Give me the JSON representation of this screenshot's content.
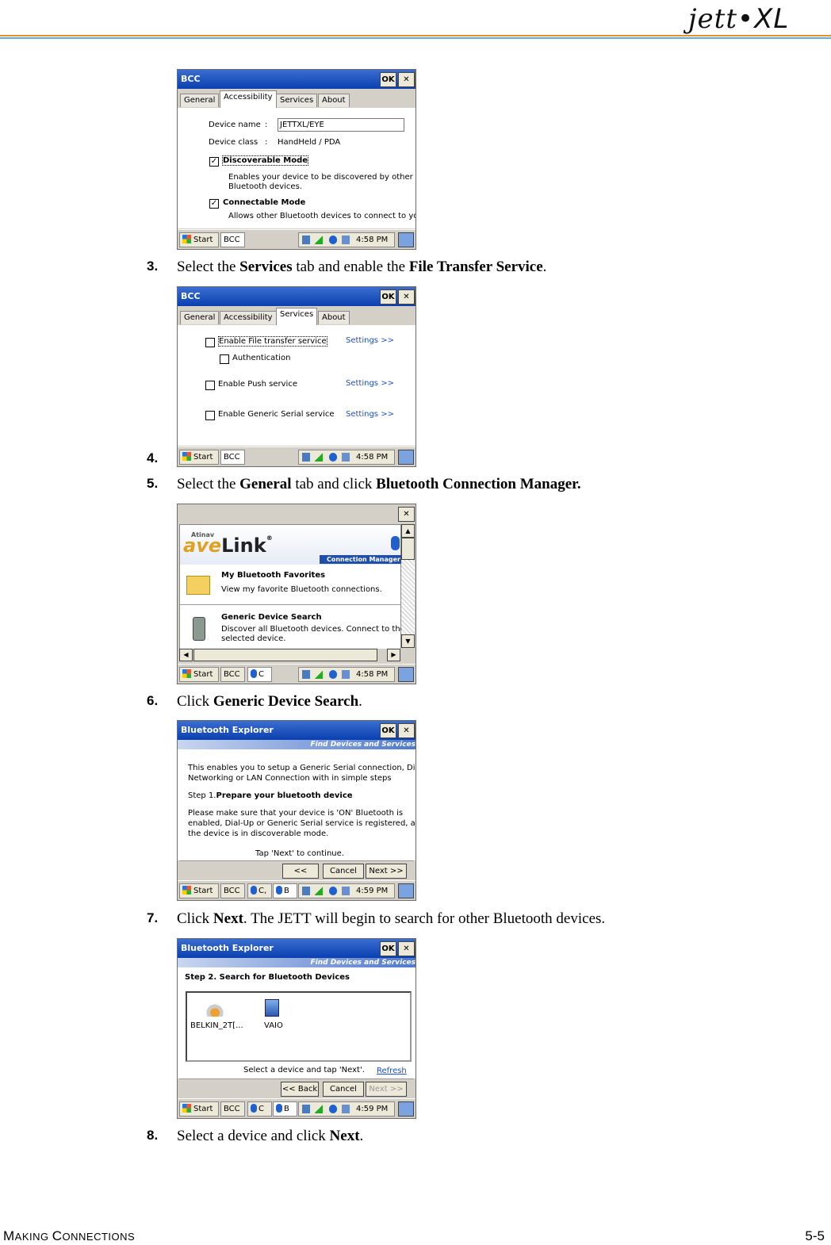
{
  "header": {
    "logo_main": "jett",
    "logo_suffix": "XL"
  },
  "footer": {
    "section_first_1": "M",
    "section_rest_1": "AKING ",
    "section_first_2": "C",
    "section_rest_2": "ONNECTIONS",
    "page": "5-5"
  },
  "steps": [
    {
      "num": "3.",
      "pre": "Select the ",
      "b1": "Services",
      "mid": " tab and enable the ",
      "b2": "File Transfer Service",
      "post": "."
    },
    {
      "num": "4.",
      "pre": "",
      "b1": "",
      "mid": "",
      "b2": "",
      "post": ""
    },
    {
      "num": "5.",
      "pre": "Select the ",
      "b1": "General",
      "mid": " tab and click ",
      "b2": "Bluetooth Connection Manager.",
      "post": ""
    },
    {
      "num": "6.",
      "pre": "Click ",
      "b1": "Generic Device Search",
      "mid": ".",
      "b2": "",
      "post": ""
    },
    {
      "num": "7.",
      "pre": "Click ",
      "b1": "Next",
      "mid": ". The JETT will begin to search for other Bluetooth devices.",
      "b2": "",
      "post": ""
    },
    {
      "num": "8.",
      "pre": "Select a device and click ",
      "b1": "Next",
      "mid": ".",
      "b2": "",
      "post": ""
    }
  ],
  "common": {
    "ok": "OK",
    "close": "✕",
    "start": "Start",
    "bcc": "BCC",
    "time1": "4:58 PM",
    "time2": "4:59 PM",
    "c": "C",
    "cc": "C,",
    "b": "B"
  },
  "shot1": {
    "title": "BCC",
    "tabs": [
      "General",
      "Accessibility",
      "Services",
      "About"
    ],
    "device_name_label": "Device name",
    "colon": ":",
    "device_name_value": "JETTXL/EYE",
    "device_class_label": "Device class",
    "device_class_value": "HandHeld / PDA",
    "discoverable": "Discoverable Mode",
    "discoverable_desc1": "Enables your device to be discovered by other",
    "discoverable_desc2": "Bluetooth devices.",
    "connectable": "Connectable Mode",
    "connectable_desc": "Allows other Bluetooth devices to connect to you.",
    "check": "✓"
  },
  "shot2": {
    "title": "BCC",
    "tabs": [
      "General",
      "Accessibility",
      "Services",
      "About"
    ],
    "items": [
      "Enable File transfer service",
      "Authentication",
      "Enable Push service",
      "Enable Generic Serial service"
    ],
    "settings": "Settings >>"
  },
  "shot3": {
    "brand_small": "Atinav",
    "brand_ave": "ave",
    "brand_link": "Link",
    "reg": "®",
    "banner": "Connection Manager",
    "fav_title": "My Bluetooth Favorites",
    "fav_desc": "View my favorite Bluetooth connections.",
    "search_title": "Generic Device Search",
    "search_desc1": "Discover all Bluetooth devices. Connect to the",
    "search_desc2": "selected device."
  },
  "shot4": {
    "title": "Bluetooth Explorer",
    "banner": "Find Devices and Services",
    "p1a": "This enables you to setup a Generic Serial connection, Dial-Up",
    "p1b": "Networking or LAN Connection with in simple steps",
    "step1_pre": "Step 1.",
    "step1_b": "Prepare your bluetooth device",
    "p2a": "Please make sure that your device is 'ON' Bluetooth is",
    "p2b": "enabled, Dial-Up or Generic Serial service is registered, and",
    "p2c": "the device is in discoverable mode.",
    "tap": "Tap 'Next' to continue.",
    "back": "<< Back",
    "cancel": "Cancel",
    "next": "Next >>"
  },
  "shot5": {
    "title": "Bluetooth Explorer",
    "banner": "Find Devices and Services",
    "step2": "Step 2. Search for Bluetooth Devices",
    "dev1": "BELKIN_2T[...",
    "dev2": "VAIO",
    "hint": "Select a device and tap 'Next'.",
    "refresh": "Refresh",
    "back": "<< Back",
    "cancel": "Cancel",
    "next": "Next >>"
  }
}
